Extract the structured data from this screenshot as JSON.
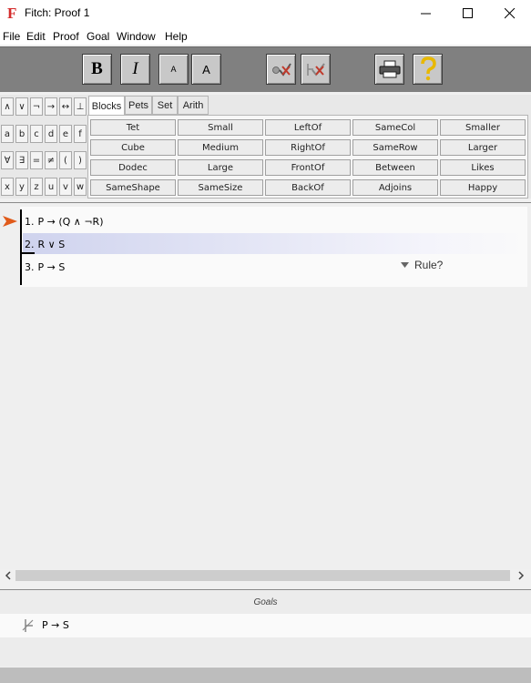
{
  "window": {
    "title": "Fitch: Proof 1",
    "icon": "fitch-f-icon"
  },
  "menu": [
    "File",
    "Edit",
    "Proof",
    "Goal",
    "Window",
    "Help"
  ],
  "toolbar": {
    "bold": "B",
    "italic": "I",
    "smaller_font": "A",
    "larger_font": "A",
    "verify_icon": "check-verify-icon",
    "goal_check_icon": "check-goal-icon",
    "print_icon": "printer-icon",
    "help_icon": "question-mark-icon"
  },
  "symbols": [
    [
      "∧",
      "∨",
      "¬",
      "→",
      "↔",
      "⊥"
    ],
    [
      "a",
      "b",
      "c",
      "d",
      "e",
      "f"
    ],
    [
      "∀",
      "∃",
      "=",
      "≠",
      "(",
      ")"
    ],
    [
      "x",
      "y",
      "z",
      "u",
      "v",
      "w"
    ]
  ],
  "palette_tabs": [
    "Blocks",
    "Pets",
    "Set",
    "Arith"
  ],
  "predicates": [
    [
      "Tet",
      "Small",
      "LeftOf",
      "SameCol",
      "Smaller"
    ],
    [
      "Cube",
      "Medium",
      "RightOf",
      "SameRow",
      "Larger"
    ],
    [
      "Dodec",
      "Large",
      "FrontOf",
      "Between",
      "Likes"
    ],
    [
      "SameShape",
      "SameSize",
      "BackOf",
      "Adjoins",
      "Happy"
    ]
  ],
  "proof": {
    "lines": [
      {
        "num": "1.",
        "text": "P → (Q ∧ ¬R)"
      },
      {
        "num": "2.",
        "text": "R ∨ S"
      },
      {
        "num": "3.",
        "text": "P → S"
      }
    ],
    "rule_label": "Rule?"
  },
  "goals": {
    "title": "Goals",
    "items": [
      {
        "text": "P → S"
      }
    ]
  }
}
